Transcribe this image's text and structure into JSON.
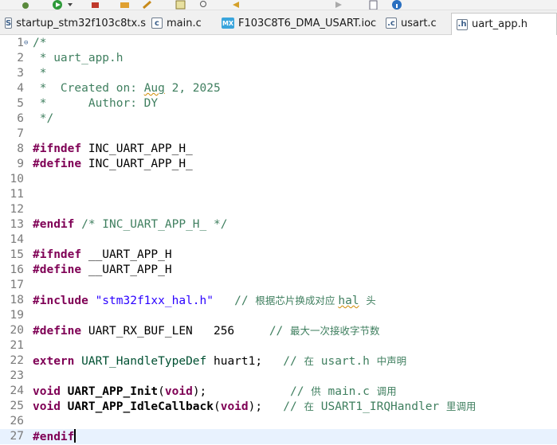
{
  "toolbar": {
    "icons": [
      "debug-icon",
      "run-icon",
      "run-dropdown-icon",
      "external-tools-icon",
      "open-folder-icon",
      "pen-icon",
      "build-icon",
      "search-icon",
      "navigate-back-icon",
      "navigate-forward-icon",
      "open-file-icon",
      "info-icon"
    ]
  },
  "tabs": [
    {
      "icon": "S",
      "label": "startup_stm32f103c8tx.s",
      "active": false
    },
    {
      "icon": "c",
      "label": "main.c",
      "active": false
    },
    {
      "icon": "MX",
      "label": "F103C8T6_DMA_USART.ioc",
      "active": false
    },
    {
      "icon": ".c",
      "label": "usart.c",
      "active": false
    },
    {
      "icon": ".h",
      "label": "uart_app.h",
      "active": true
    }
  ],
  "editor": {
    "current_line": 27,
    "lines": [
      {
        "n": "1",
        "fold": "⊖",
        "parts": [
          {
            "t": "/*",
            "c": "cm"
          }
        ]
      },
      {
        "n": "2",
        "parts": [
          {
            "t": " * uart_app.h",
            "c": "cm"
          }
        ]
      },
      {
        "n": "3",
        "parts": [
          {
            "t": " *",
            "c": "cm"
          }
        ]
      },
      {
        "n": "4",
        "parts": [
          {
            "t": " *  Created on: ",
            "c": "cm"
          },
          {
            "t": "Aug",
            "c": "cm warn"
          },
          {
            "t": " 2, 2025",
            "c": "cm"
          }
        ]
      },
      {
        "n": "5",
        "parts": [
          {
            "t": " *      Author: DY",
            "c": "cm"
          }
        ]
      },
      {
        "n": "6",
        "parts": [
          {
            "t": " */",
            "c": "cm"
          }
        ]
      },
      {
        "n": "7",
        "parts": []
      },
      {
        "n": "8",
        "parts": [
          {
            "t": "#ifndef",
            "c": "kw"
          },
          {
            "t": " INC_UART_APP_H_",
            "c": ""
          }
        ]
      },
      {
        "n": "9",
        "parts": [
          {
            "t": "#define",
            "c": "kw"
          },
          {
            "t": " INC_UART_APP_H_",
            "c": ""
          }
        ]
      },
      {
        "n": "10",
        "parts": []
      },
      {
        "n": "11",
        "parts": []
      },
      {
        "n": "12",
        "parts": []
      },
      {
        "n": "13",
        "parts": [
          {
            "t": "#endif",
            "c": "kw"
          },
          {
            "t": " /* INC_UART_APP_H_ */",
            "c": "cm"
          }
        ]
      },
      {
        "n": "14",
        "parts": []
      },
      {
        "n": "15",
        "parts": [
          {
            "t": "#ifndef",
            "c": "kw"
          },
          {
            "t": " __UART_APP_H",
            "c": ""
          }
        ]
      },
      {
        "n": "16",
        "parts": [
          {
            "t": "#define",
            "c": "kw"
          },
          {
            "t": " __UART_APP_H",
            "c": ""
          }
        ]
      },
      {
        "n": "17",
        "parts": []
      },
      {
        "n": "18",
        "parts": [
          {
            "t": "#include",
            "c": "kw"
          },
          {
            "t": " ",
            "c": ""
          },
          {
            "t": "\"stm32f1xx_hal.h\"",
            "c": "str"
          },
          {
            "t": "   // ",
            "c": "cm"
          },
          {
            "t": "根据芯片换成对应 ",
            "c": "cm cmcjk"
          },
          {
            "t": "hal",
            "c": "cm warn"
          },
          {
            "t": " ",
            "c": "cm"
          },
          {
            "t": "头",
            "c": "cm cmcjk"
          }
        ]
      },
      {
        "n": "19",
        "parts": []
      },
      {
        "n": "20",
        "parts": [
          {
            "t": "#define",
            "c": "kw"
          },
          {
            "t": " UART_RX_BUF_LEN   256     ",
            "c": ""
          },
          {
            "t": "// ",
            "c": "cm"
          },
          {
            "t": "最大一次接收字节数",
            "c": "cm cmcjk"
          }
        ]
      },
      {
        "n": "21",
        "parts": []
      },
      {
        "n": "22",
        "parts": [
          {
            "t": "extern",
            "c": "kw"
          },
          {
            "t": " ",
            "c": ""
          },
          {
            "t": "UART_HandleTypeDef",
            "c": "tp"
          },
          {
            "t": " huart1;   ",
            "c": ""
          },
          {
            "t": "// ",
            "c": "cm"
          },
          {
            "t": "在",
            "c": "cm cmcjk"
          },
          {
            "t": " usart.h ",
            "c": "cm"
          },
          {
            "t": "中声明",
            "c": "cm cmcjk"
          }
        ]
      },
      {
        "n": "23",
        "parts": []
      },
      {
        "n": "24",
        "parts": [
          {
            "t": "void",
            "c": "kw"
          },
          {
            "t": " ",
            "c": ""
          },
          {
            "t": "UART_APP_Init",
            "c": "fn"
          },
          {
            "t": "(",
            "c": ""
          },
          {
            "t": "void",
            "c": "kw"
          },
          {
            "t": ");            ",
            "c": ""
          },
          {
            "t": "// ",
            "c": "cm"
          },
          {
            "t": "供",
            "c": "cm cmcjk"
          },
          {
            "t": " main.c ",
            "c": "cm"
          },
          {
            "t": "调用",
            "c": "cm cmcjk"
          }
        ]
      },
      {
        "n": "25",
        "parts": [
          {
            "t": "void",
            "c": "kw"
          },
          {
            "t": " ",
            "c": ""
          },
          {
            "t": "UART_APP_IdleCallback",
            "c": "fn"
          },
          {
            "t": "(",
            "c": ""
          },
          {
            "t": "void",
            "c": "kw"
          },
          {
            "t": ");   ",
            "c": ""
          },
          {
            "t": "// ",
            "c": "cm"
          },
          {
            "t": "在",
            "c": "cm cmcjk"
          },
          {
            "t": " USART1_IRQHandler ",
            "c": "cm"
          },
          {
            "t": "里调用",
            "c": "cm cmcjk"
          }
        ]
      },
      {
        "n": "26",
        "parts": []
      },
      {
        "n": "27",
        "parts": [
          {
            "t": "#endif",
            "c": "kw"
          }
        ],
        "caret": true
      }
    ]
  }
}
